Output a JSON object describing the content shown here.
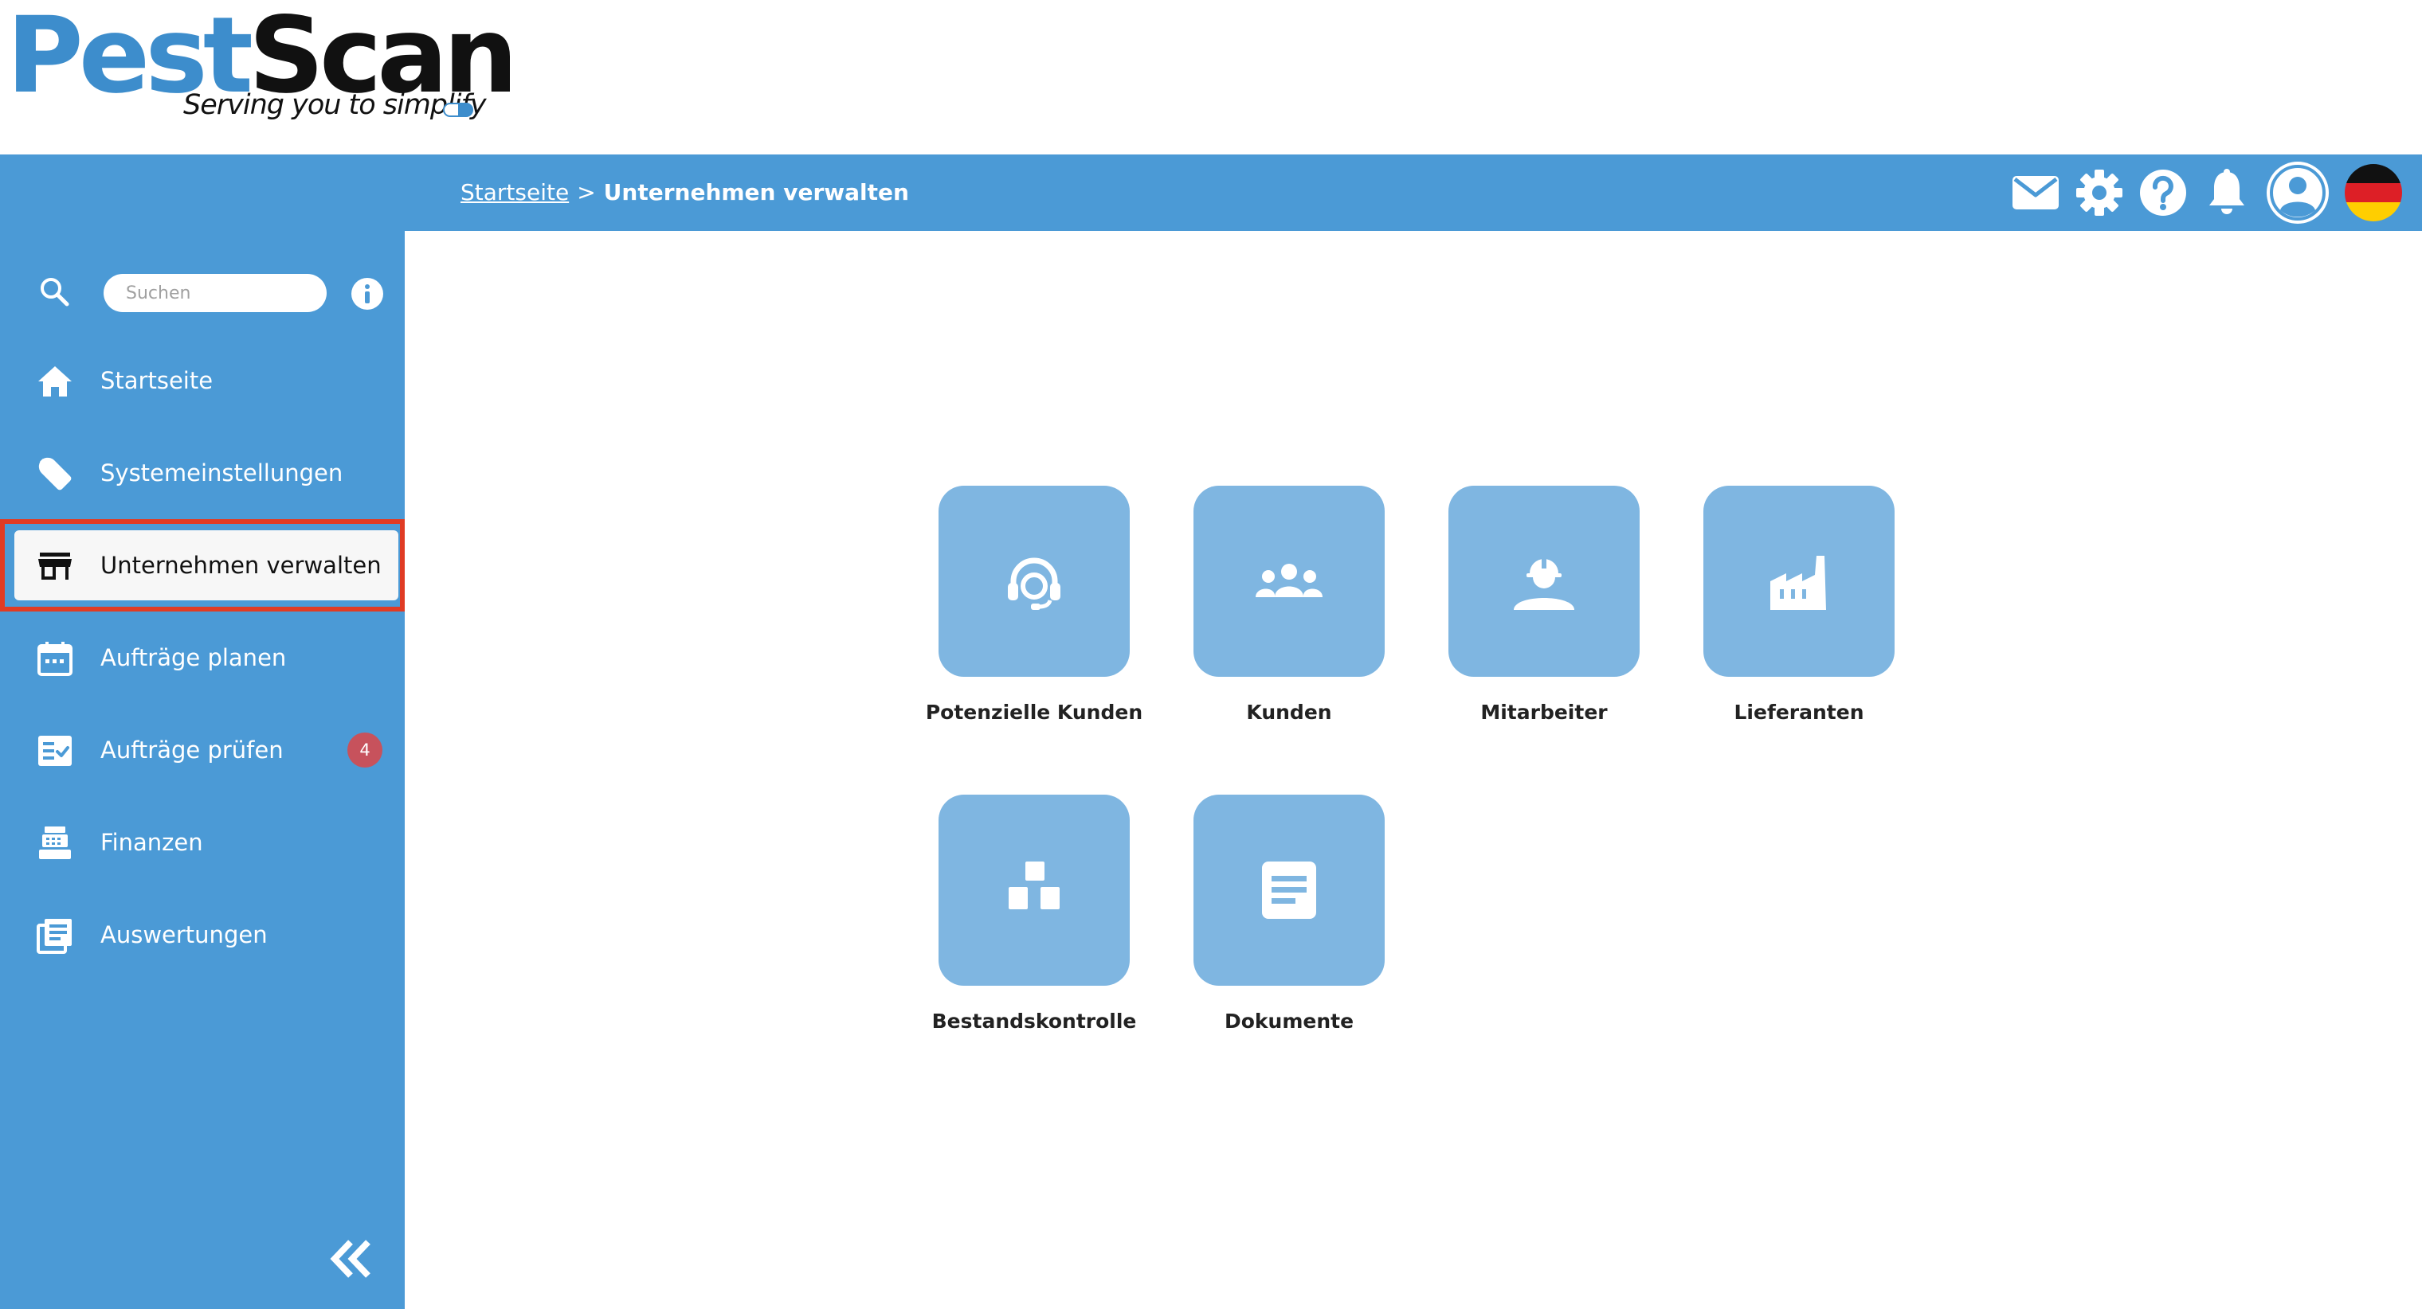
{
  "brand": {
    "name_part1": "Pest",
    "name_part2": "Scan",
    "tagline": "Serving you to simplify",
    "colors": {
      "primary": "#4b9ad6",
      "logo_blue": "#3d8dcc",
      "tile": "#7fb6e1",
      "highlight": "#e03b24",
      "badge": "#c7525c"
    }
  },
  "breadcrumb": {
    "home": "Startseite",
    "separator": ">",
    "current": "Unternehmen verwalten"
  },
  "topbar": {
    "icons": [
      "mail-icon",
      "gear-icon",
      "help-icon",
      "bell-icon",
      "user-avatar-icon",
      "germany-flag-icon"
    ]
  },
  "sidebar": {
    "search": {
      "placeholder": "Suchen",
      "value": ""
    },
    "items": [
      {
        "label": "Startseite",
        "icon": "home-icon"
      },
      {
        "label": "Systemeinstellungen",
        "icon": "wrench-icon"
      },
      {
        "label": "Unternehmen verwalten",
        "icon": "store-icon",
        "active": true
      },
      {
        "label": "Aufträge planen",
        "icon": "calendar-icon"
      },
      {
        "label": "Aufträge prüfen",
        "icon": "checklist-icon",
        "badge": "4"
      },
      {
        "label": "Finanzen",
        "icon": "cash-register-icon"
      },
      {
        "label": "Auswertungen",
        "icon": "report-icon"
      }
    ],
    "collapse_icon": "double-chevron-left-icon"
  },
  "main": {
    "tiles": [
      {
        "label": "Potenzielle Kunden",
        "icon": "headset-icon"
      },
      {
        "label": "Kunden",
        "icon": "group-icon"
      },
      {
        "label": "Mitarbeiter",
        "icon": "worker-icon"
      },
      {
        "label": "Lieferanten",
        "icon": "factory-icon"
      },
      {
        "label": "Bestandskontrolle",
        "icon": "boxes-icon"
      },
      {
        "label": "Dokumente",
        "icon": "document-icon"
      }
    ]
  }
}
